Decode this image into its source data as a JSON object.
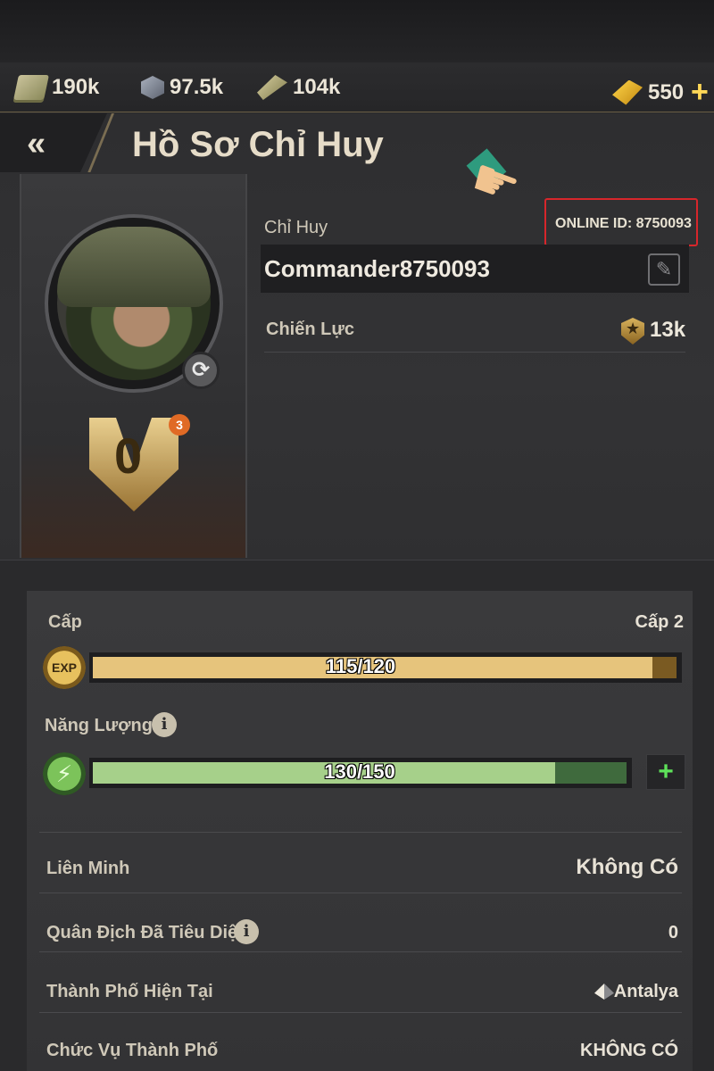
{
  "resources": {
    "cash": "190k",
    "steel": "97.5k",
    "ammo": "104k",
    "gold": "550",
    "gold_plus": "+"
  },
  "header": {
    "back_label": "«",
    "title": "Hồ Sơ Chỉ Huy"
  },
  "profile": {
    "refresh_icon": "⟳",
    "rank_letter": "0",
    "rank_badge_count": "3",
    "commander_label": "Chỉ Huy",
    "online_id": "ONLINE ID: 8750093",
    "commander_name": "Commander8750093",
    "edit_icon": "✎",
    "power_label": "Chiến Lực",
    "power_value": "13k",
    "power_star": "★"
  },
  "stats": {
    "level_label": "Cấp",
    "level_value": "Cấp 2",
    "exp_icon_label": "EXP",
    "exp_text": "115/120",
    "exp_current": 115,
    "exp_max": 120,
    "energy_label": "Năng Lượng",
    "info_glyph": "i",
    "energy_icon": "⚡",
    "energy_text": "130/150",
    "energy_current": 130,
    "energy_max": 150,
    "energy_plus": "+",
    "rows": [
      {
        "label": "Liên Minh",
        "value": "Không Có"
      },
      {
        "label": "Quân Địch Đã Tiêu Diệt",
        "value": "0"
      },
      {
        "label": "Thành Phố Hiện Tại",
        "value": "Antalya"
      },
      {
        "label": "Chức Vụ Thành Phố",
        "value": "KHÔNG CÓ"
      }
    ]
  },
  "colors": {
    "exp_fill": "#e6c47c",
    "energy_fill": "#a6d08a",
    "highlight_border": "#d7262b",
    "accent_gold": "#ffd857"
  }
}
